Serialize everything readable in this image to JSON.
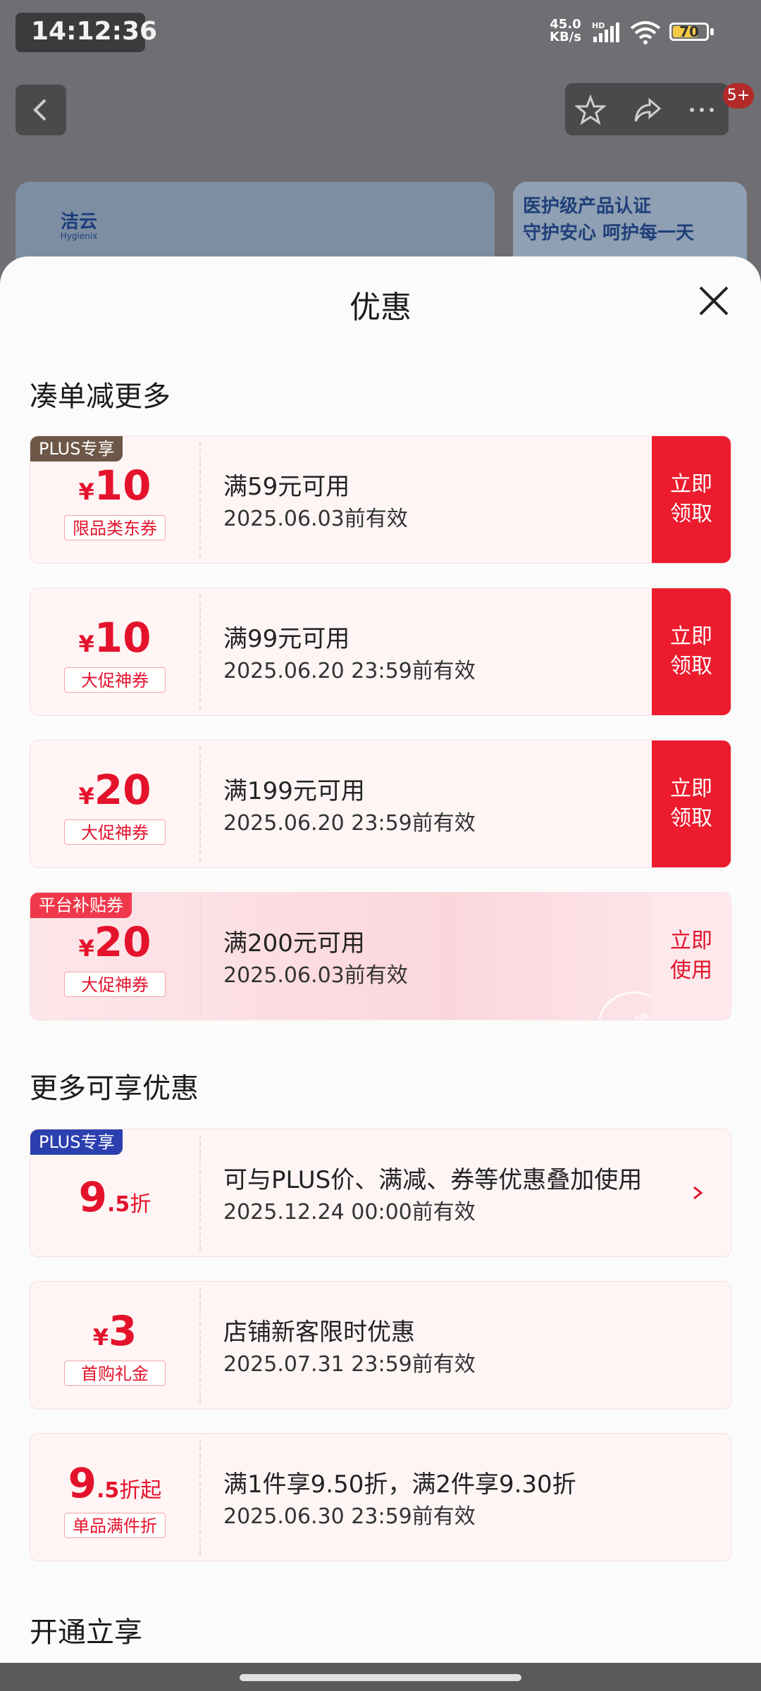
{
  "status_bar": {
    "time": "14:12:36",
    "net_speed_value": "45.0",
    "net_speed_unit": "KB/s",
    "network": "HD",
    "battery": "70"
  },
  "nav": {
    "badge": "5+"
  },
  "background": {
    "brand_logo": "洁云",
    "brand_logo_sub": "Hygienix",
    "right_banner_line1": "医护级产品认证",
    "right_banner_line2": "守护安心 呵护每一天"
  },
  "sheet": {
    "title": "优惠",
    "section1_title": "凑单减更多",
    "section2_title": "更多可享优惠",
    "section3_title": "开通立享"
  },
  "coupons": [
    {
      "corner": "PLUS专享",
      "yen": "¥",
      "amount": "10",
      "tag": "限品类东券",
      "condition": "满59元可用",
      "date": "2025.06.03前有效",
      "button": "立即领取"
    },
    {
      "yen": "¥",
      "amount": "10",
      "tag": "大促神券",
      "condition": "满99元可用",
      "date": "2025.06.20 23:59前有效",
      "button": "立即领取"
    },
    {
      "yen": "¥",
      "amount": "20",
      "tag": "大促神券",
      "condition": "满199元可用",
      "date": "2025.06.20 23:59前有效",
      "button": "立即领取"
    },
    {
      "corner": "平台补贴券",
      "yen": "¥",
      "amount": "20",
      "tag": "大促神券",
      "condition": "满200元可用",
      "date": "2025.06.03前有效",
      "button": "立即使用",
      "stamp": "已领"
    }
  ],
  "offers": [
    {
      "corner": "PLUS专享",
      "amount": "9",
      "decimal": ".5",
      "suffix": "折",
      "condition": "可与PLUS价、满减、券等优惠叠加使用",
      "date": "2025.12.24 00:00前有效"
    },
    {
      "yen": "¥",
      "amount": "3",
      "tag": "首购礼金",
      "condition": "店铺新客限时优惠",
      "date": "2025.07.31 23:59前有效"
    },
    {
      "amount": "9",
      "decimal": ".5",
      "suffix": "折起",
      "tag": "单品满件折",
      "condition": "满1件享9.50折，满2件享9.30折",
      "date": "2025.06.30 23:59前有效"
    }
  ]
}
